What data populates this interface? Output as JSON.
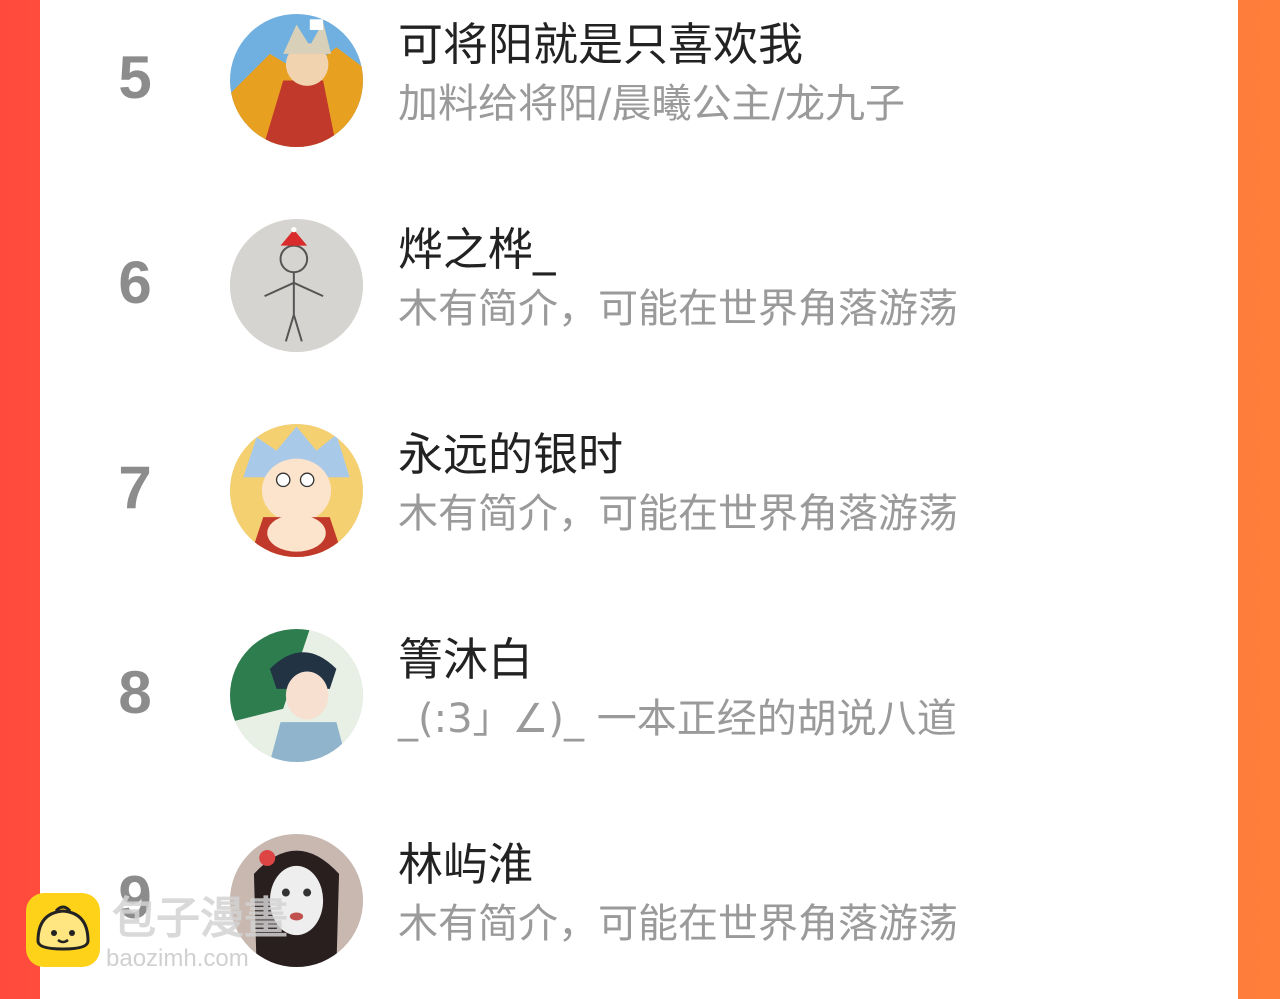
{
  "list": [
    {
      "rank": "5",
      "name": "可将阳就是只喜欢我",
      "bio": "加料给将阳/晨曦公主/龙九子"
    },
    {
      "rank": "6",
      "name": "烨之桦_",
      "bio": "木有简介，可能在世界角落游荡"
    },
    {
      "rank": "7",
      "name": "永远的银时",
      "bio": "木有简介，可能在世界角落游荡"
    },
    {
      "rank": "8",
      "name": "箐沐白",
      "bio": "_(:3」∠)_ 一本正经的胡说八道"
    },
    {
      "rank": "9",
      "name": "林屿淮",
      "bio": "木有简介，可能在世界角落游荡"
    }
  ],
  "watermark": {
    "title": "包子漫畫",
    "url": "baozimh.com"
  },
  "colors": {
    "accent_left": "#ff4a3d",
    "accent_right": "#ff7e3a",
    "rank": "#8c8c8c",
    "name": "#222222",
    "bio": "#9a9a9a"
  }
}
